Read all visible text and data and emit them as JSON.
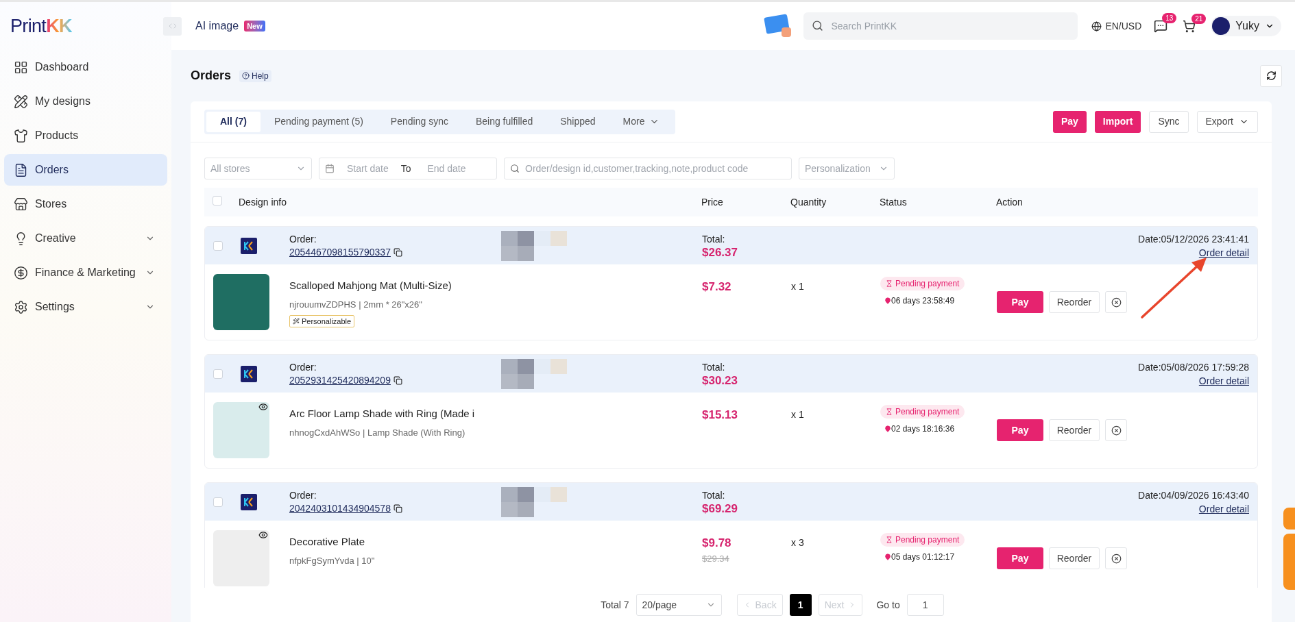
{
  "sidebar": {
    "logo": {
      "text": "Print",
      "mark": "KK"
    },
    "items": [
      {
        "label": "Dashboard",
        "selected": false,
        "expandable": false
      },
      {
        "label": "My designs",
        "selected": false,
        "expandable": false
      },
      {
        "label": "Products",
        "selected": false,
        "expandable": false
      },
      {
        "label": "Orders",
        "selected": true,
        "expandable": false
      },
      {
        "label": "Stores",
        "selected": false,
        "expandable": false
      },
      {
        "label": "Creative",
        "selected": false,
        "expandable": true
      },
      {
        "label": "Finance & Marketing",
        "selected": false,
        "expandable": true
      },
      {
        "label": "Settings",
        "selected": false,
        "expandable": true
      }
    ]
  },
  "topbar": {
    "ai_image": "AI image",
    "ai_badge": "New",
    "search": {
      "placeholder": "Search PrintKK"
    },
    "locale": "EN/USD",
    "messages_count": "13",
    "cart_count": "21",
    "user": "Yuky"
  },
  "page": {
    "title": "Orders",
    "help": "Help"
  },
  "tabs": [
    {
      "label": "All (7)",
      "selected": true,
      "dropdown": false
    },
    {
      "label": "Pending payment (5)",
      "selected": false,
      "dropdown": false
    },
    {
      "label": "Pending sync",
      "selected": false,
      "dropdown": false
    },
    {
      "label": "Being fulfilled",
      "selected": false,
      "dropdown": false
    },
    {
      "label": "Shipped",
      "selected": false,
      "dropdown": false
    },
    {
      "label": "More",
      "selected": false,
      "dropdown": true
    }
  ],
  "actions": [
    {
      "label": "Pay",
      "kind": "primary"
    },
    {
      "label": "Import",
      "kind": "primary"
    },
    {
      "label": "Sync",
      "kind": "plain"
    },
    {
      "label": "Export",
      "kind": "dropdown"
    }
  ],
  "filters": {
    "stores": {
      "placeholder": "All stores"
    },
    "start_date": {
      "placeholder": "Start date"
    },
    "to": "To",
    "end_date": {
      "placeholder": "End date"
    },
    "search": {
      "placeholder": "Order/design id,customer,tracking,note,product code"
    },
    "personalization": {
      "placeholder": "Personalization"
    }
  },
  "table": {
    "select_all": {
      "checked": false
    },
    "columns": [
      "Design info",
      "Price",
      "Quantity",
      "Status",
      "Action"
    ]
  },
  "orders": [
    {
      "checked": false,
      "order_label": "Order:",
      "order_id": "2054467098155790337",
      "total_label": "Total:",
      "total": "$26.37",
      "date": "Date:05/12/2026 23:41:41",
      "detail_link": "Order detail",
      "item": {
        "title": "Scalloped Mahjong Mat (Multi-Size)",
        "variant": "njrouumvZDPHS | 2mm * 26\"x26\"",
        "tag": "Personalizable",
        "previewable": false,
        "price": "$7.32",
        "quantity": "x 1",
        "status": "Pending payment",
        "countdown": "06 days 23:58:49",
        "pay": "Pay",
        "reorder": "Reorder"
      }
    },
    {
      "checked": false,
      "order_label": "Order:",
      "order_id": "2052931425420894209",
      "total_label": "Total:",
      "total": "$30.23",
      "date": "Date:05/08/2026 17:59:28",
      "detail_link": "Order detail",
      "item": {
        "title": "Arc Floor Lamp Shade with Ring (Made i",
        "variant": "nhnogCxdAhWSo | Lamp Shade (With Ring)",
        "previewable": true,
        "price": "$15.13",
        "quantity": "x 1",
        "status": "Pending payment",
        "countdown": "02 days 18:16:36",
        "pay": "Pay",
        "reorder": "Reorder"
      }
    },
    {
      "checked": false,
      "order_label": "Order:",
      "order_id": "2042403101434904578",
      "total_label": "Total:",
      "total": "$69.29",
      "date": "Date:04/09/2026 16:43:40",
      "detail_link": "Order detail",
      "item": {
        "title": "Decorative Plate",
        "variant": "nfpkFgSymYvda | 10\"",
        "previewable": true,
        "price": "$9.78",
        "original_price": "$29.34",
        "quantity": "x 3",
        "status": "Pending payment",
        "countdown": "05 days 01:12:17",
        "pay": "Pay",
        "reorder": "Reorder"
      }
    }
  ],
  "pagination": {
    "total": "Total 7",
    "page_size": "20/page",
    "back": {
      "label": "Back",
      "disabled": true
    },
    "pages": [
      {
        "label": "1",
        "selected": true
      }
    ],
    "next": {
      "label": "Next",
      "disabled": true
    },
    "goto_label": "Go to",
    "goto_value": "1"
  }
}
